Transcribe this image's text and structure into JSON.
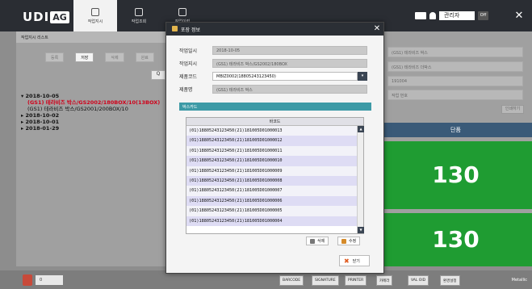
{
  "header": {
    "logo_text": "UDI",
    "logo_badge": "AG",
    "tabs": [
      {
        "label": "작업지시",
        "active": true
      },
      {
        "label": "작업조회",
        "active": false
      },
      {
        "label": "작업이력",
        "active": false
      }
    ],
    "user_label": "관리자",
    "logout_label": "Off",
    "close_symbol": "✕"
  },
  "left_panel": {
    "title": "작업지시 리스트",
    "buttons": [
      "등록",
      "저장",
      "삭제",
      "완료"
    ],
    "search_symbol": "Q",
    "tree": [
      {
        "date": "2018-10-05",
        "children": [
          {
            "text": "(GS1) 테라비즈 박스/GS2002/180BOX/10(13BOX)",
            "selected": true
          },
          {
            "text": "(GS1) 테라비즈 박스/GS2001/200BOX/10",
            "selected": false
          }
        ]
      },
      {
        "date": "2018-10-02",
        "children": []
      },
      {
        "date": "2018-10-01",
        "children": []
      },
      {
        "date": "2018-01-29",
        "children": []
      }
    ]
  },
  "right_panel": {
    "fields": [
      "(GS1) 테라비즈 박스",
      "(GS1) 테라비즈 더박스",
      "191004",
      "작업 번호"
    ],
    "print_button": "인쇄하기",
    "unit_label": "단품",
    "counts": [
      130,
      130
    ]
  },
  "modal": {
    "title": "포장 정보",
    "close_symbol": "✕",
    "fields": [
      {
        "label": "작업일시",
        "value": "2018-10-05"
      },
      {
        "label": "작업지시",
        "value": "(GS1) 테라비즈 박스/GS2002/180BOX"
      },
      {
        "label": "제품코드",
        "value": "MBIZ0002(18805243123450)"
      },
      {
        "label": "제품명",
        "value": "(GS1) 테라비즈 박스"
      }
    ],
    "dropdown_symbol": "▾",
    "section_title": "박스카드",
    "table_header": "바코드",
    "barcodes": [
      "(01)18805243123450(21)181005D01000013",
      "(01)18805243123450(21)181005D01000012",
      "(01)18805243123450(21)181005D01000011",
      "(01)18805243123450(21)181005D01000010",
      "(01)18805243123450(21)181005D01000009",
      "(01)18805243123450(21)181005D01000008",
      "(01)18805243123450(21)181005D01000007",
      "(01)18805243123450(21)181005D01000006",
      "(01)18805243123450(21)181005D01000005",
      "(01)18805243123450(21)181005D01000004"
    ],
    "delete_label": "삭제",
    "edit_label": "수정",
    "close_label": "닫기"
  },
  "bottom": {
    "count_value": "0",
    "tools": [
      "BARCODE",
      "SIGNATURE",
      "PRINTER",
      "카메라",
      "VAL OID",
      "환경설정"
    ],
    "brand": "Metallic"
  },
  "colors": {
    "accent_green": "#1f9c32",
    "modal_header": "#2b2f35",
    "section_teal": "#3d9aa6",
    "selected_red": "#d0021b"
  }
}
